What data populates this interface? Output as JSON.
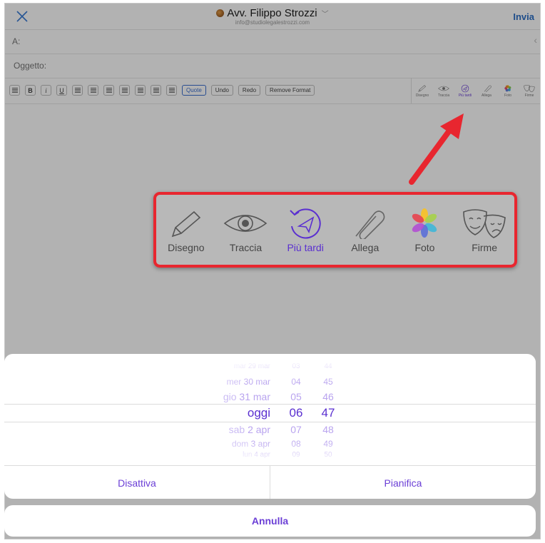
{
  "header": {
    "sender_name": "Avv. Filippo Strozzi",
    "sender_email": "info@studiolegalestrozzi.com",
    "send_label": "Invia"
  },
  "fields": {
    "to_label": "A:",
    "subject_placeholder": "Oggetto:"
  },
  "toolbar": {
    "format_buttons": {
      "bold": "B",
      "italic": "i",
      "underline": "U",
      "quote": "Quote",
      "undo": "Undo",
      "redo": "Redo",
      "remove_format": "Remove Format"
    },
    "tools": [
      {
        "label": "Disegno",
        "icon": "pencil-icon"
      },
      {
        "label": "Traccia",
        "icon": "eye-icon"
      },
      {
        "label": "Più tardi",
        "icon": "send-later-icon",
        "active": true
      },
      {
        "label": "Allega",
        "icon": "paperclip-icon"
      },
      {
        "label": "Foto",
        "icon": "photos-icon"
      },
      {
        "label": "Firme",
        "icon": "masks-icon"
      }
    ]
  },
  "picker": {
    "rows": [
      {
        "weekday": "mar",
        "date": "29 mar",
        "hour": "03",
        "minute": "44"
      },
      {
        "weekday": "mer",
        "date": "30 mar",
        "hour": "04",
        "minute": "45"
      },
      {
        "weekday": "gio",
        "date": "31 mar",
        "hour": "05",
        "minute": "46"
      },
      {
        "weekday": "",
        "date": "oggi",
        "hour": "06",
        "minute": "47"
      },
      {
        "weekday": "sab",
        "date": "2 apr",
        "hour": "07",
        "minute": "48"
      },
      {
        "weekday": "dom",
        "date": "3 apr",
        "hour": "08",
        "minute": "49"
      },
      {
        "weekday": "lun",
        "date": "4 apr",
        "hour": "09",
        "minute": "50"
      }
    ]
  },
  "actions": {
    "disable_label": "Disattiva",
    "schedule_label": "Pianifica",
    "cancel_label": "Annulla"
  },
  "colors": {
    "accent": "#6b3fd6",
    "highlight_red": "#e8262f",
    "send_blue": "#2b6fc6"
  }
}
